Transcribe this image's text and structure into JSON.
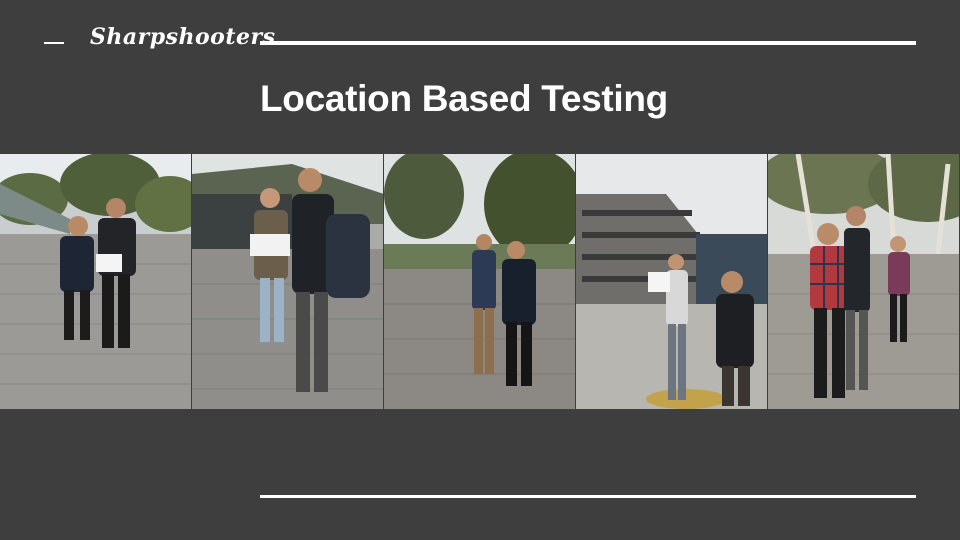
{
  "slide": {
    "brand": "Sharpshooters",
    "title": "Location Based Testing"
  },
  "photos": [
    {
      "subject": "two-students-plaza"
    },
    {
      "subject": "student-with-clipboard"
    },
    {
      "subject": "students-pointing-phones"
    },
    {
      "subject": "library-building-pose"
    },
    {
      "subject": "group-walking-eucalyptus"
    }
  ],
  "colors": {
    "background": "#3e3e3e",
    "text": "#ffffff"
  }
}
